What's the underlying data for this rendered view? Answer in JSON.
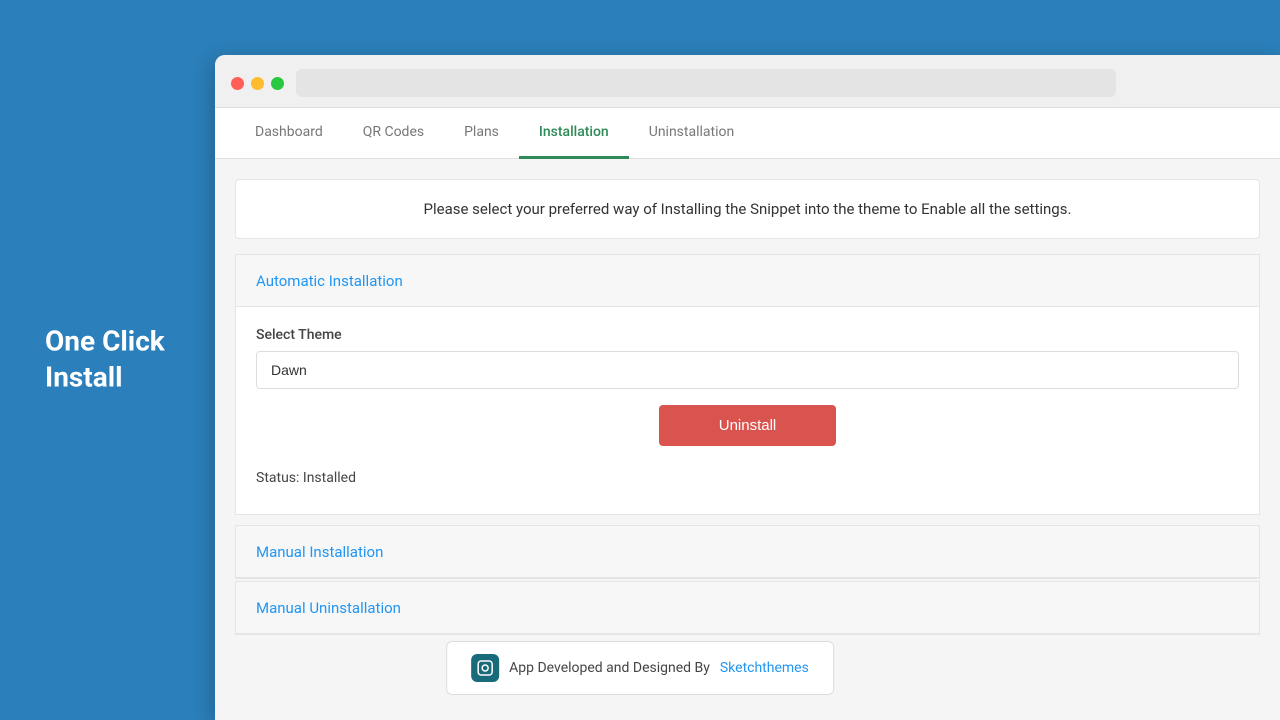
{
  "sidebar": {
    "title_line1": "One Click",
    "title_line2": "Install"
  },
  "browser": {
    "traffic_lights": [
      "red",
      "yellow",
      "green"
    ]
  },
  "nav": {
    "tabs": [
      {
        "label": "Dashboard",
        "active": false
      },
      {
        "label": "QR Codes",
        "active": false
      },
      {
        "label": "Plans",
        "active": false
      },
      {
        "label": "Installation",
        "active": true
      },
      {
        "label": "Uninstallation",
        "active": false
      }
    ]
  },
  "main": {
    "instruction": "Please select your preferred way of Installing the Snippet into the theme to Enable all the settings.",
    "automatic_installation_label": "Automatic Installation",
    "select_theme_label": "Select Theme",
    "theme_value": "Dawn",
    "uninstall_button": "Uninstall",
    "status_text": "Status: Installed",
    "manual_installation_label": "Manual Installation",
    "manual_uninstallation_label": "Manual Uninstallation"
  },
  "footer": {
    "badge_text": "App Developed and Designed By",
    "brand_link": "Sketchthemes"
  }
}
